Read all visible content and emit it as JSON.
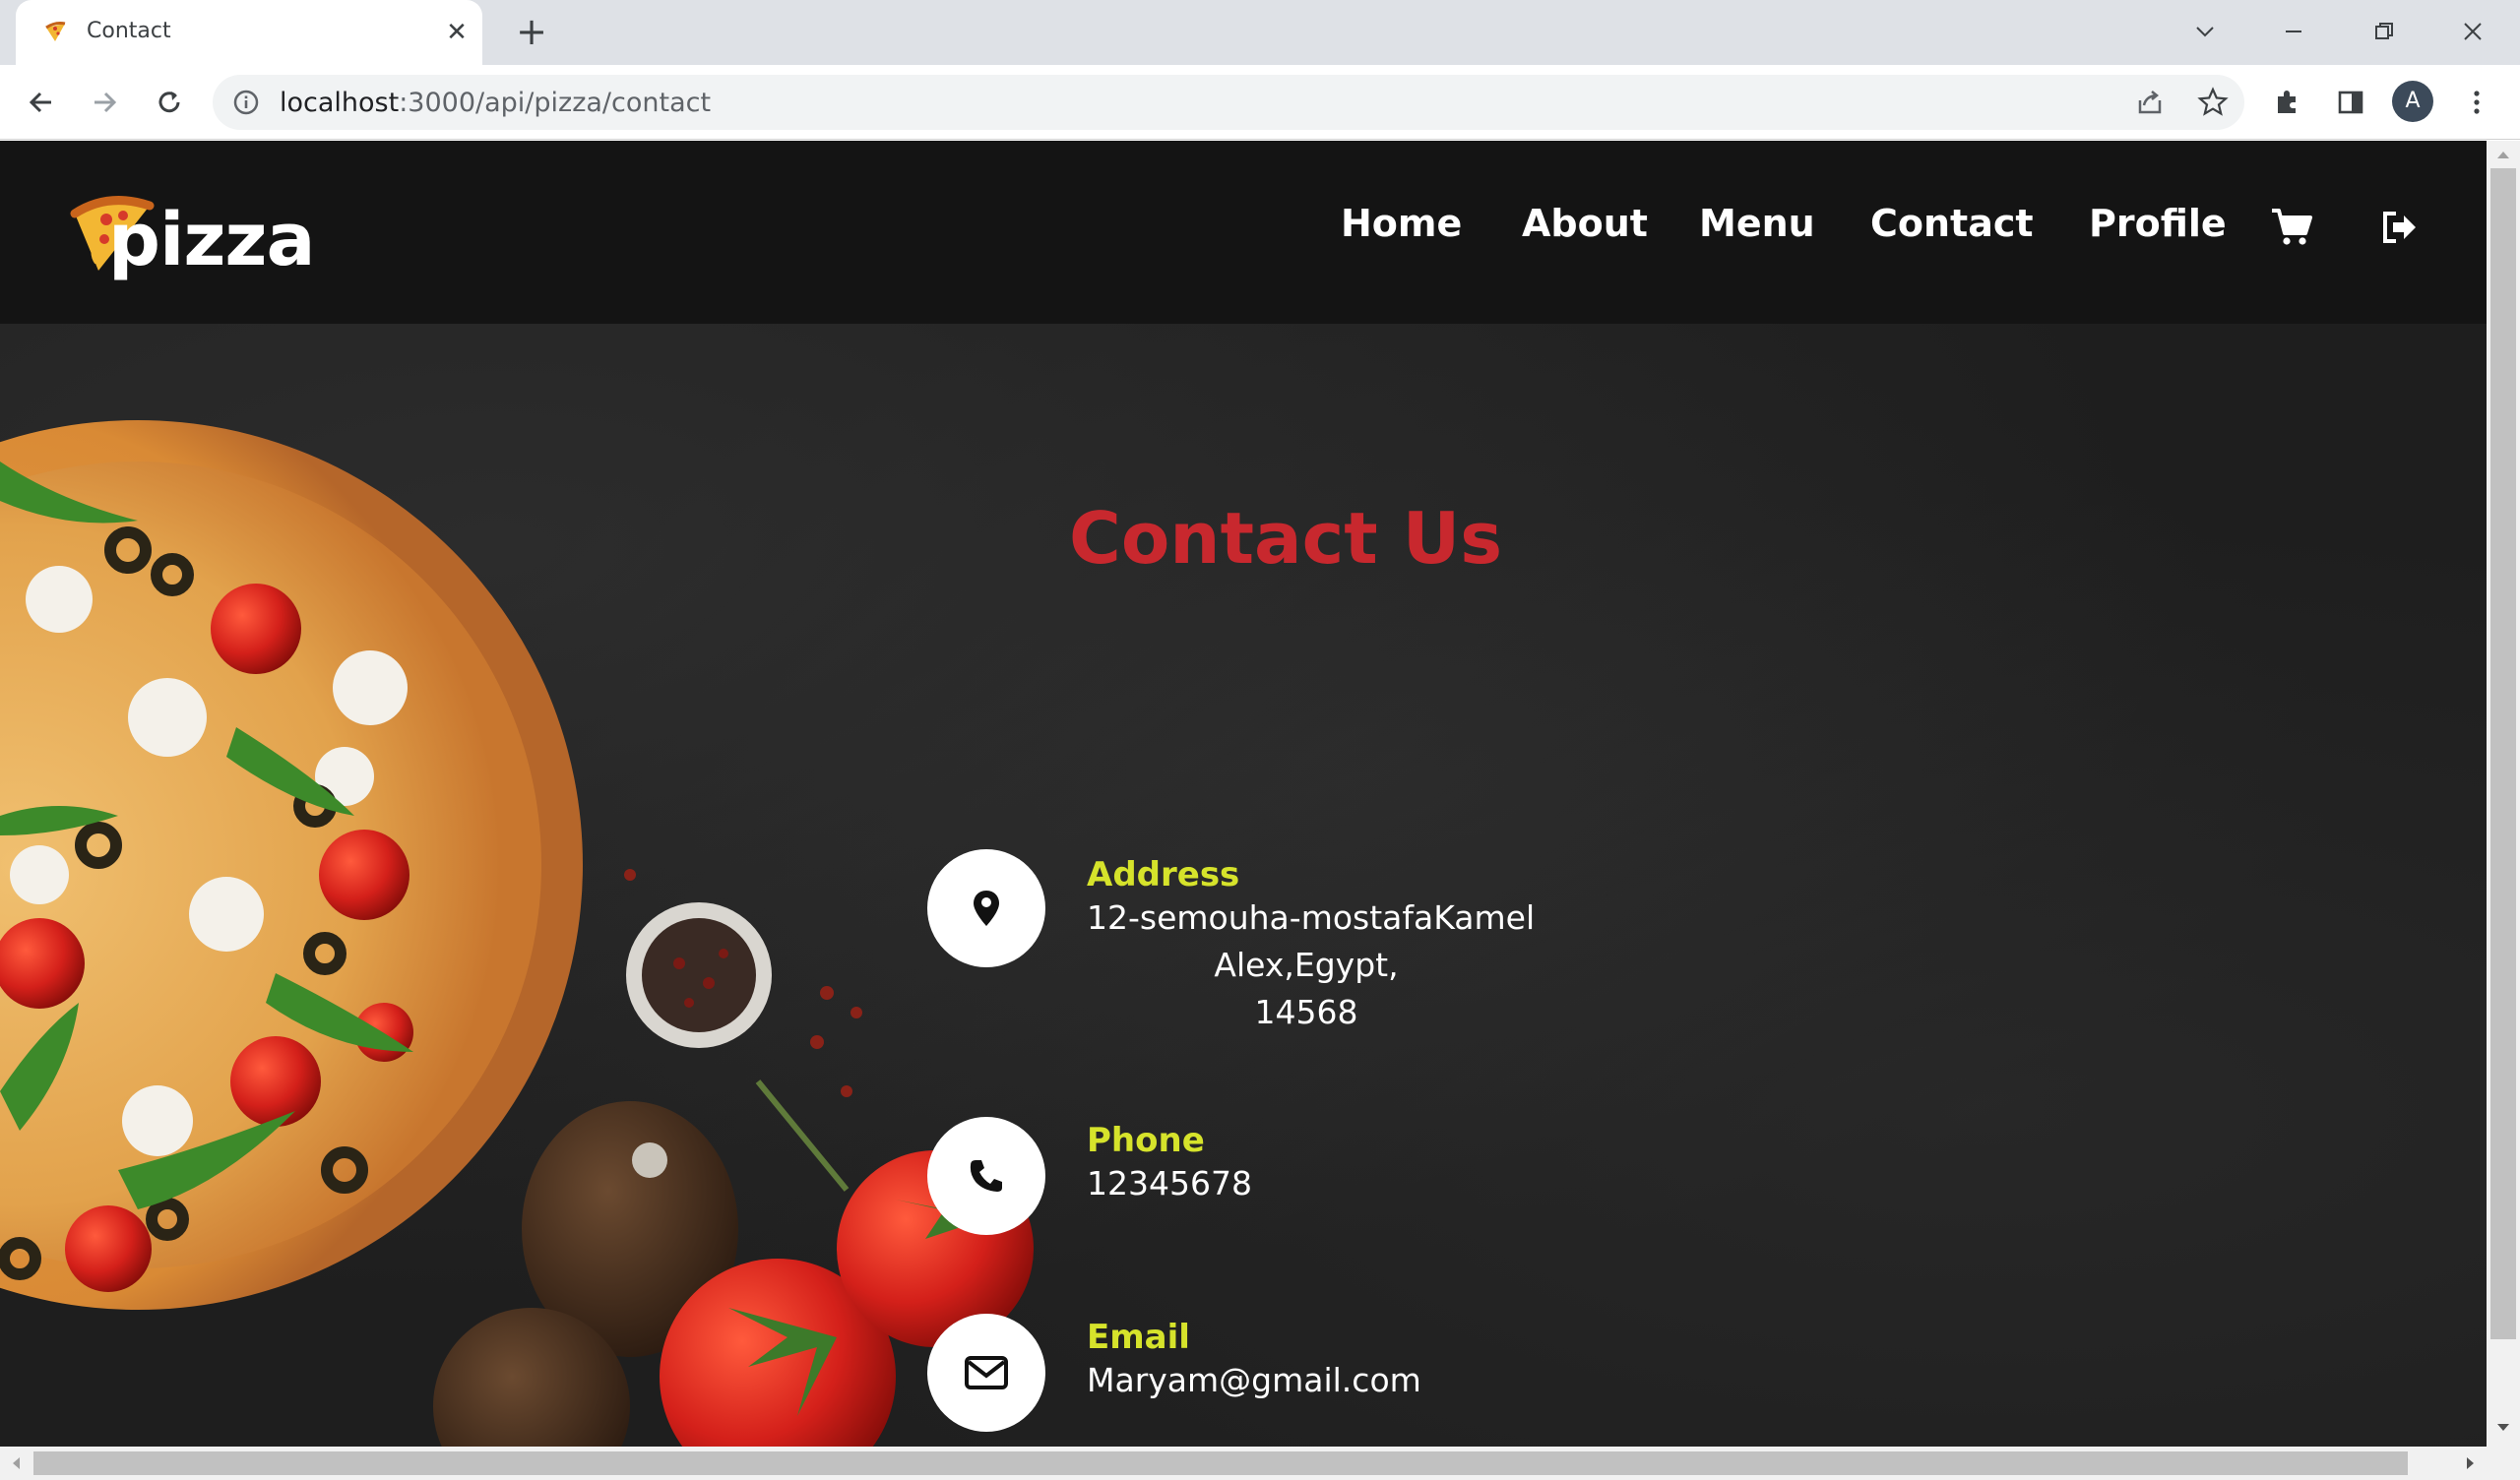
{
  "browser": {
    "tab_title": "Contact",
    "url_host": "localhost",
    "url_path": ":3000/api/pizza/contact",
    "profile_initial": "A"
  },
  "site": {
    "logo_text": "pizza",
    "nav": [
      "Home",
      "About",
      "Menu",
      "Contact",
      "Profile"
    ]
  },
  "contact": {
    "title": "Contact Us",
    "address_label": "Address",
    "address_line1": "12-semouha-mostafaKamel",
    "address_line2": "Alex,Egypt,",
    "address_line3": "14568",
    "phone_label": "Phone",
    "phone_value": "12345678",
    "email_label": "Email",
    "email_value": "Maryam@gmail.com"
  },
  "colors": {
    "accent_title": "#c8282e",
    "accent_label": "#d6e32b",
    "header_bg": "#141414"
  },
  "icons": [
    "location-pin-icon",
    "phone-icon",
    "envelope-icon",
    "cart-icon",
    "logout-icon"
  ]
}
